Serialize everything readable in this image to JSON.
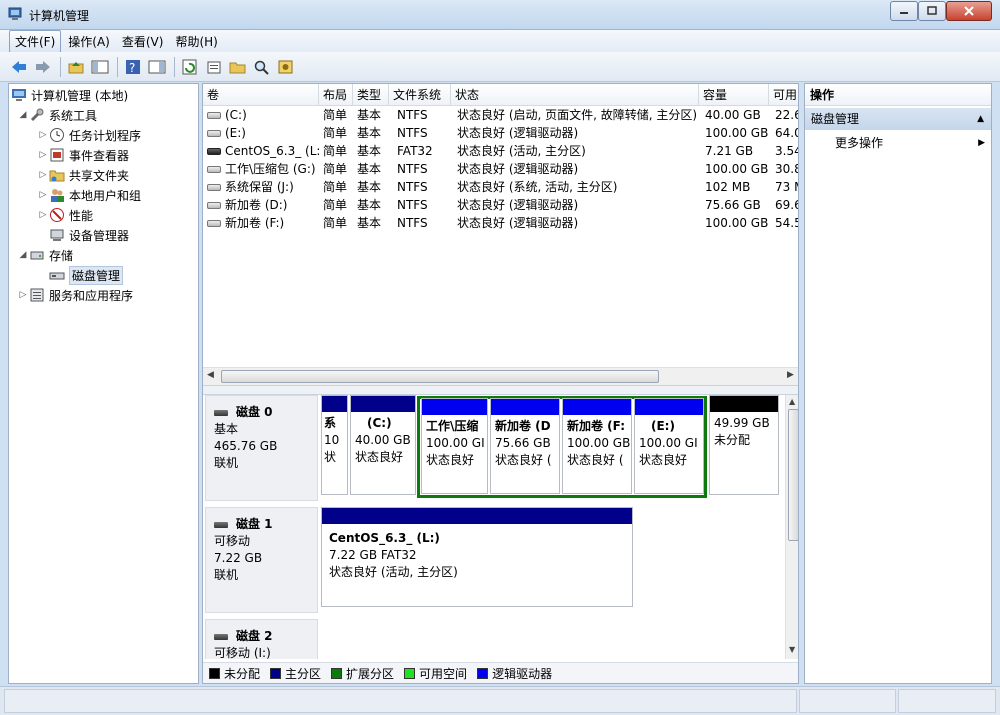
{
  "window": {
    "title": "计算机管理"
  },
  "menu": [
    "文件(F)",
    "操作(A)",
    "查看(V)",
    "帮助(H)"
  ],
  "tree": {
    "root": "计算机管理 (本地)",
    "items": [
      {
        "label": "系统工具",
        "level": 1,
        "expanded": true
      },
      {
        "label": "任务计划程序",
        "level": 2
      },
      {
        "label": "事件查看器",
        "level": 2
      },
      {
        "label": "共享文件夹",
        "level": 2
      },
      {
        "label": "本地用户和组",
        "level": 2
      },
      {
        "label": "性能",
        "level": 2
      },
      {
        "label": "设备管理器",
        "level": 2
      },
      {
        "label": "存储",
        "level": 1,
        "expanded": true
      },
      {
        "label": "磁盘管理",
        "level": 2,
        "selected": true
      },
      {
        "label": "服务和应用程序",
        "level": 1
      }
    ]
  },
  "volumes": {
    "columns": [
      "卷",
      "布局",
      "类型",
      "文件系统",
      "状态",
      "容量",
      "可用"
    ],
    "rows": [
      {
        "name": "(C:)",
        "layout": "简单",
        "type": "基本",
        "fs": "NTFS",
        "status": "状态良好 (启动, 页面文件, 故障转储, 主分区)",
        "capacity": "40.00 GB",
        "free": "22.6"
      },
      {
        "name": "(E:)",
        "layout": "简单",
        "type": "基本",
        "fs": "NTFS",
        "status": "状态良好 (逻辑驱动器)",
        "capacity": "100.00 GB",
        "free": "64.0"
      },
      {
        "name": "CentOS_6.3_ (L:)",
        "layout": "简单",
        "type": "基本",
        "fs": "FAT32",
        "status": "状态良好 (活动, 主分区)",
        "capacity": "7.21 GB",
        "free": "3.54"
      },
      {
        "name": "工作\\压缩包 (G:)",
        "layout": "简单",
        "type": "基本",
        "fs": "NTFS",
        "status": "状态良好 (逻辑驱动器)",
        "capacity": "100.00 GB",
        "free": "30.8"
      },
      {
        "name": "系统保留 (J:)",
        "layout": "简单",
        "type": "基本",
        "fs": "NTFS",
        "status": "状态良好 (系统, 活动, 主分区)",
        "capacity": "102 MB",
        "free": "73 M"
      },
      {
        "name": "新加卷 (D:)",
        "layout": "简单",
        "type": "基本",
        "fs": "NTFS",
        "status": "状态良好 (逻辑驱动器)",
        "capacity": "75.66 GB",
        "free": "69.6"
      },
      {
        "name": "新加卷 (F:)",
        "layout": "简单",
        "type": "基本",
        "fs": "NTFS",
        "status": "状态良好 (逻辑驱动器)",
        "capacity": "100.00 GB",
        "free": "54.5"
      }
    ]
  },
  "disks": [
    {
      "name": "磁盘 0",
      "type": "基本",
      "size": "465.76 GB",
      "state": "联机",
      "partitions": [
        {
          "line1": "系",
          "line2": "10",
          "line3": "状"
        },
        {
          "line1": "(C:)",
          "line2": "40.00 GB",
          "line3": "状态良好"
        },
        {
          "line1": "工作\\压缩",
          "line2": "100.00 GI",
          "line3": "状态良好"
        },
        {
          "line1": "新加卷  (D",
          "line2": "75.66 GB",
          "line3": "状态良好 ("
        },
        {
          "line1": "新加卷  (F:",
          "line2": "100.00 GB",
          "line3": "状态良好 ("
        },
        {
          "line1": "(E:)",
          "line2": "100.00 GI",
          "line3": "状态良好"
        },
        {
          "line1": "",
          "line2": "49.99 GB",
          "line3": "未分配"
        }
      ]
    },
    {
      "name": "磁盘 1",
      "type": "可移动",
      "size": "7.22 GB",
      "state": "联机",
      "partitions": [
        {
          "line1": "CentOS_6.3_  (L:)",
          "line2": "7.22 GB FAT32",
          "line3": "状态良好 (活动, 主分区)"
        }
      ]
    },
    {
      "name": "磁盘 2",
      "type": "可移动 (I:)"
    }
  ],
  "legend": [
    {
      "label": "未分配",
      "color": "#000000"
    },
    {
      "label": "主分区",
      "color": "#00008b"
    },
    {
      "label": "扩展分区",
      "color": "#0c7a0c"
    },
    {
      "label": "可用空间",
      "color": "#22e022"
    },
    {
      "label": "逻辑驱动器",
      "color": "#0000f0"
    }
  ],
  "actions": {
    "header": "操作",
    "section": "磁盘管理",
    "more": "更多操作"
  },
  "colors": {
    "primary": "#00008b",
    "logical": "#0000f0",
    "unallocated": "#000000",
    "extended": "#0c7a0c"
  }
}
